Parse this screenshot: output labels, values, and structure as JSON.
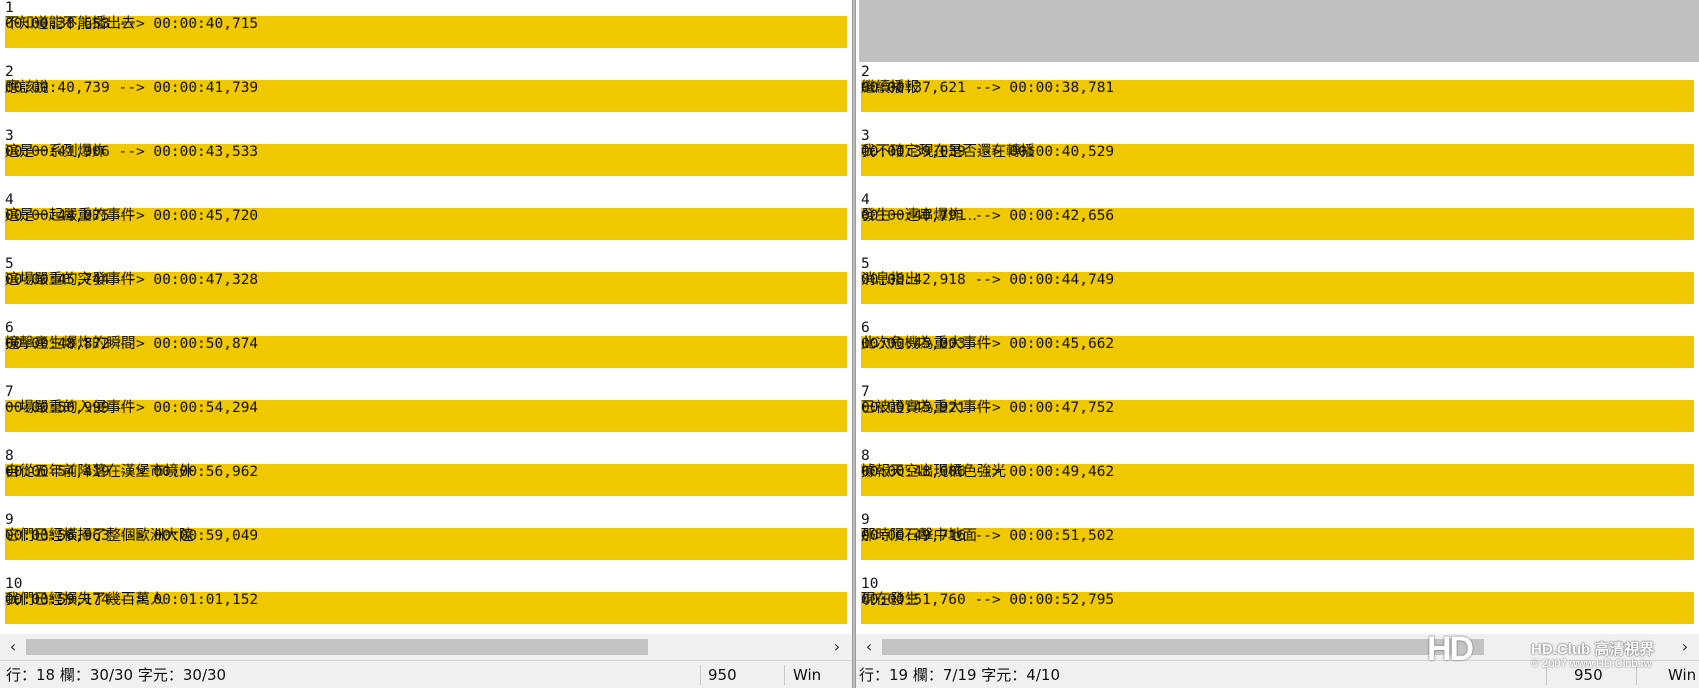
{
  "left_pane": {
    "entries": [
      {
        "index": "1",
        "time": "00:00:38,653 --> 00:00:40,715",
        "text": "不知道能不能播出去"
      },
      {
        "index": "2",
        "time": "00:00:40,739 --> 00:00:41,739",
        "text": "應該說"
      },
      {
        "index": "3",
        "time": "00:00:41,906 --> 00:00:43,533",
        "text": "這是一系列爆炸"
      },
      {
        "index": "4",
        "time": "00:00:44,075 --> 00:00:45,720",
        "text": "這是一起嚴重的事件"
      },
      {
        "index": "5",
        "time": "00:00:45,744 --> 00:00:47,328",
        "text": "這場嚴重的突發事件"
      },
      {
        "index": "6",
        "time": "00:00:48,872 --> 00:00:50,874",
        "text": "撞擊產生爆炸的瞬間"
      },
      {
        "index": "7",
        "time": "00:00:50,999 --> 00:00:54,294",
        "text": "一場嚴重的入侵事件"
      },
      {
        "index": "8",
        "time": "00:00:54,419 --> 00:00:56,962",
        "text": "自從五年前降落在漢堡市境外"
      },
      {
        "index": "9",
        "time": "00:00:56,963 --> 00:00:59,049",
        "text": "它們已經橫掃了整個歐洲大陸"
      },
      {
        "index": "10",
        "time": "00:00:59,174 --> 00:01:01,152",
        "text": "我們已經損失了幾百萬人"
      }
    ],
    "status": {
      "position": "行：18  欄：30/30  字元：30/30",
      "codepage": "950",
      "eol": "Win"
    }
  },
  "right_pane": {
    "entries": [
      {
        "index": "2",
        "time": "00:00:37,621 --> 00:00:38,781",
        "text": "繼續播報"
      },
      {
        "index": "3",
        "time": "00:00:39,039 --> 00:00:40,529",
        "text": "我不確定現在是否還在轉播"
      },
      {
        "index": "4",
        "time": "00:00:40,791 --> 00:00:42,656",
        "text": "發生一連串爆炸…"
      },
      {
        "index": "5",
        "time": "00:00:42,918 --> 00:00:44,749",
        "text": "消息指出"
      },
      {
        "index": "6",
        "time": "00:00:45,003 --> 00:00:45,662",
        "text": "此次危機為重大事件"
      },
      {
        "index": "7",
        "time": "00:00:45,921 --> 00:00:47,752",
        "text": "已被證實為重大事件"
      },
      {
        "index": "8",
        "time": "00:00:48,006 --> 00:00:49,462",
        "text": "據報天空出現橘色強光"
      },
      {
        "index": "9",
        "time": "00:00:49,716 --> 00:00:51,502",
        "text": "那時隕石擊中地面"
      },
      {
        "index": "10",
        "time": "00:00:51,760 --> 00:00:52,795",
        "text": "現在發生"
      }
    ],
    "status": {
      "position": "行：19  欄：7/19  字元：4/10",
      "codepage": "950",
      "eol": "Win"
    }
  },
  "scroll_icons": {
    "left": "chevron-left-icon",
    "right": "chevron-right-icon"
  },
  "colors": {
    "highlight": "#f0c800",
    "gray_block": "#c0c0c0"
  },
  "watermark": {
    "logo": "HD",
    "name": "HD.Club 高清視界",
    "copy": "© 2007 www.HD.Club.tw"
  }
}
